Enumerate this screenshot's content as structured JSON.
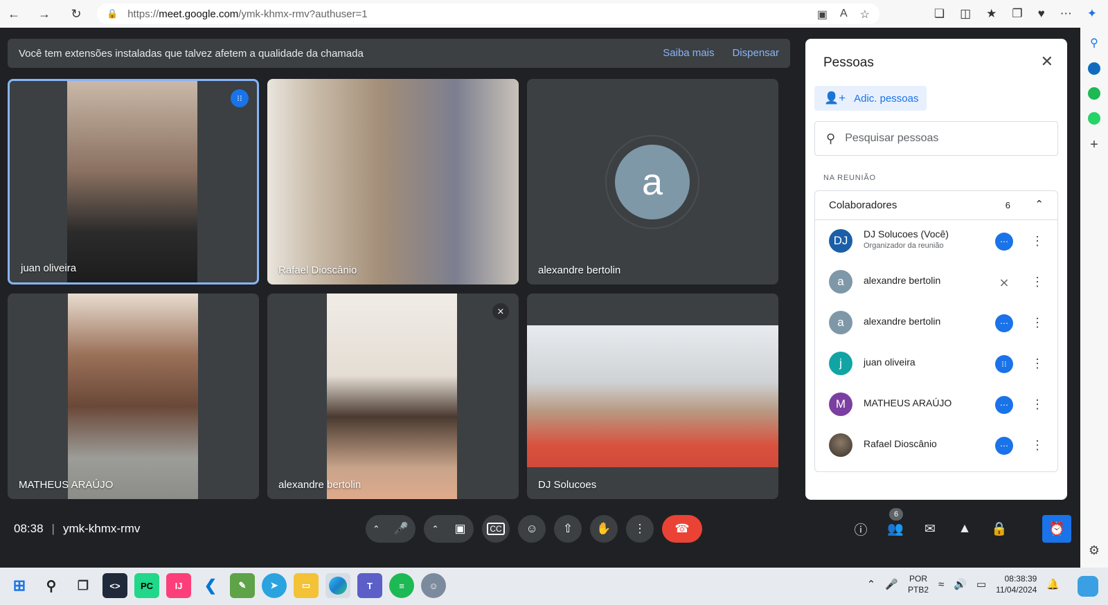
{
  "browser": {
    "url_prefix": "https://",
    "url_host": "meet.google.com",
    "url_path": "/ymk-khmx-rmv?authuser=1"
  },
  "banner": {
    "message": "Você tem extensões instaladas que talvez afetem a qualidade da chamada",
    "learn_more": "Saiba mais",
    "dismiss": "Dispensar"
  },
  "tiles": [
    {
      "name": "juan oliveira",
      "video_bg": "#6b5f55"
    },
    {
      "name": "Rafael Dioscânio",
      "video_bg": "#9a8a78"
    },
    {
      "name": "alexandre bertolin",
      "avatar_letter": "a"
    },
    {
      "name": "MATHEUS ARAÚJO",
      "video_bg": "#8a7362"
    },
    {
      "name": "alexandre bertolin",
      "video_bg": "#b5a79a"
    },
    {
      "name": "DJ Solucoes",
      "video_bg": "#a89a8c"
    }
  ],
  "meeting": {
    "time": "08:38",
    "separator": "|",
    "code": "ymk-khmx-rmv",
    "participant_count": "6"
  },
  "people": {
    "title": "Pessoas",
    "add_people": "Adic. pessoas",
    "search_placeholder": "Pesquisar pessoas",
    "section_label": "NA REUNIÃO",
    "group_name": "Colaboradores",
    "group_count": "6",
    "list": [
      {
        "initials": "DJ",
        "name": "DJ Solucoes (Você)",
        "subtitle": "Organizador da reunião",
        "color": "#1a5fa8",
        "status": "more"
      },
      {
        "initials": "a",
        "name": "alexandre bertolin",
        "color": "#7f98a8",
        "status": "muted"
      },
      {
        "initials": "a",
        "name": "alexandre bertolin",
        "color": "#7f98a8",
        "status": "more"
      },
      {
        "initials": "j",
        "name": "juan oliveira",
        "color": "#12a4a4",
        "status": "speaking"
      },
      {
        "initials": "M",
        "name": "MATHEUS ARAÚJO",
        "color": "#7b3fa0",
        "status": "more"
      },
      {
        "initials": "",
        "name": "Rafael Dioscânio",
        "color": "#5a4a3a",
        "status": "more"
      }
    ]
  },
  "taskbar": {
    "lang": "POR",
    "layout": "PTB2",
    "clock_time": "08:38:39",
    "clock_date": "11/04/2024"
  }
}
